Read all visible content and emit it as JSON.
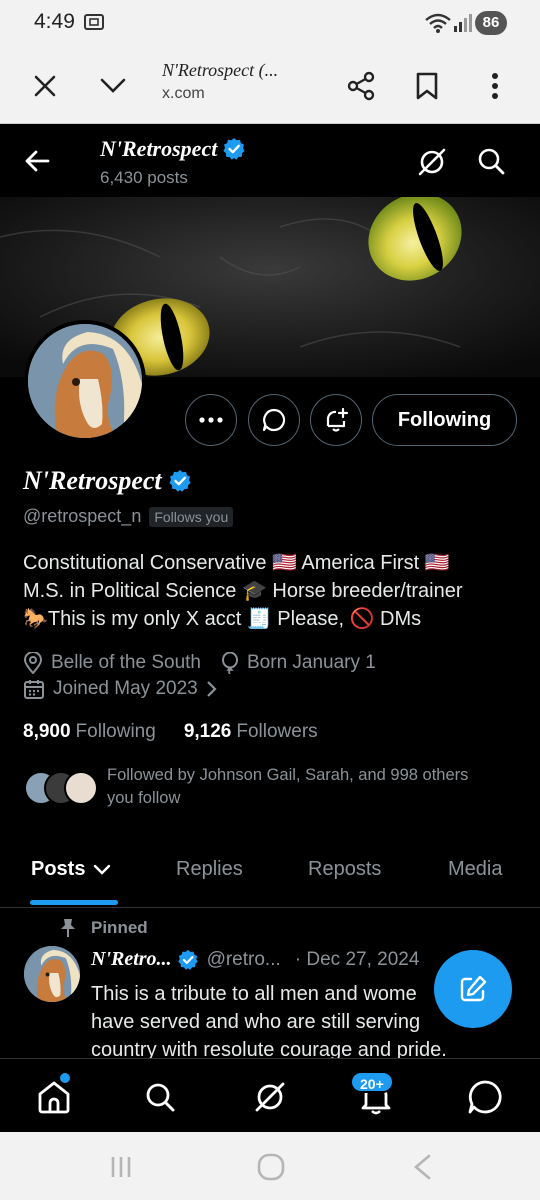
{
  "status_bar": {
    "time": "4:49",
    "battery": "86"
  },
  "browser": {
    "page_title": "N'Retrospect (...",
    "url": "x.com"
  },
  "header": {
    "name": "N'Retrospect",
    "post_count": "6,430 posts"
  },
  "profile": {
    "name": "N'Retrospect",
    "handle": "@retrospect_n",
    "follows_you": "Follows you",
    "following_button": "Following",
    "bio_lines": [
      "Constitutional Conservative 🇺🇸 America First 🇺🇸",
      "M.S. in Political Science 🎓 Horse breeder/trainer",
      "🐎This is my only X acct 🧾 Please, 🚫 DMs"
    ],
    "location": "Belle of the South",
    "birthday": "Born January 1",
    "joined": "Joined May 2023",
    "following_count": "8,900",
    "following_label": "Following",
    "followers_count": "9,126",
    "followers_label": "Followers",
    "followed_by_line1": "Followed by Johnson Gail, Sarah, and 998 others",
    "followed_by_line2": "you follow"
  },
  "tabs": [
    "Posts",
    "Replies",
    "Reposts",
    "Media"
  ],
  "pinned_post": {
    "pinned_label": "Pinned",
    "name": "N'Retro...",
    "handle": "@retro...",
    "date": "· Dec 27, 2024",
    "text_lines": [
      "This is a tribute to all men and wome",
      "have served and who are still serving",
      "country with resolute courage and pride."
    ]
  },
  "bottom_nav": {
    "notifications_badge": "20+"
  },
  "colors": {
    "accent": "#1d9bf0",
    "background": "#000000",
    "muted": "#8b9298"
  }
}
